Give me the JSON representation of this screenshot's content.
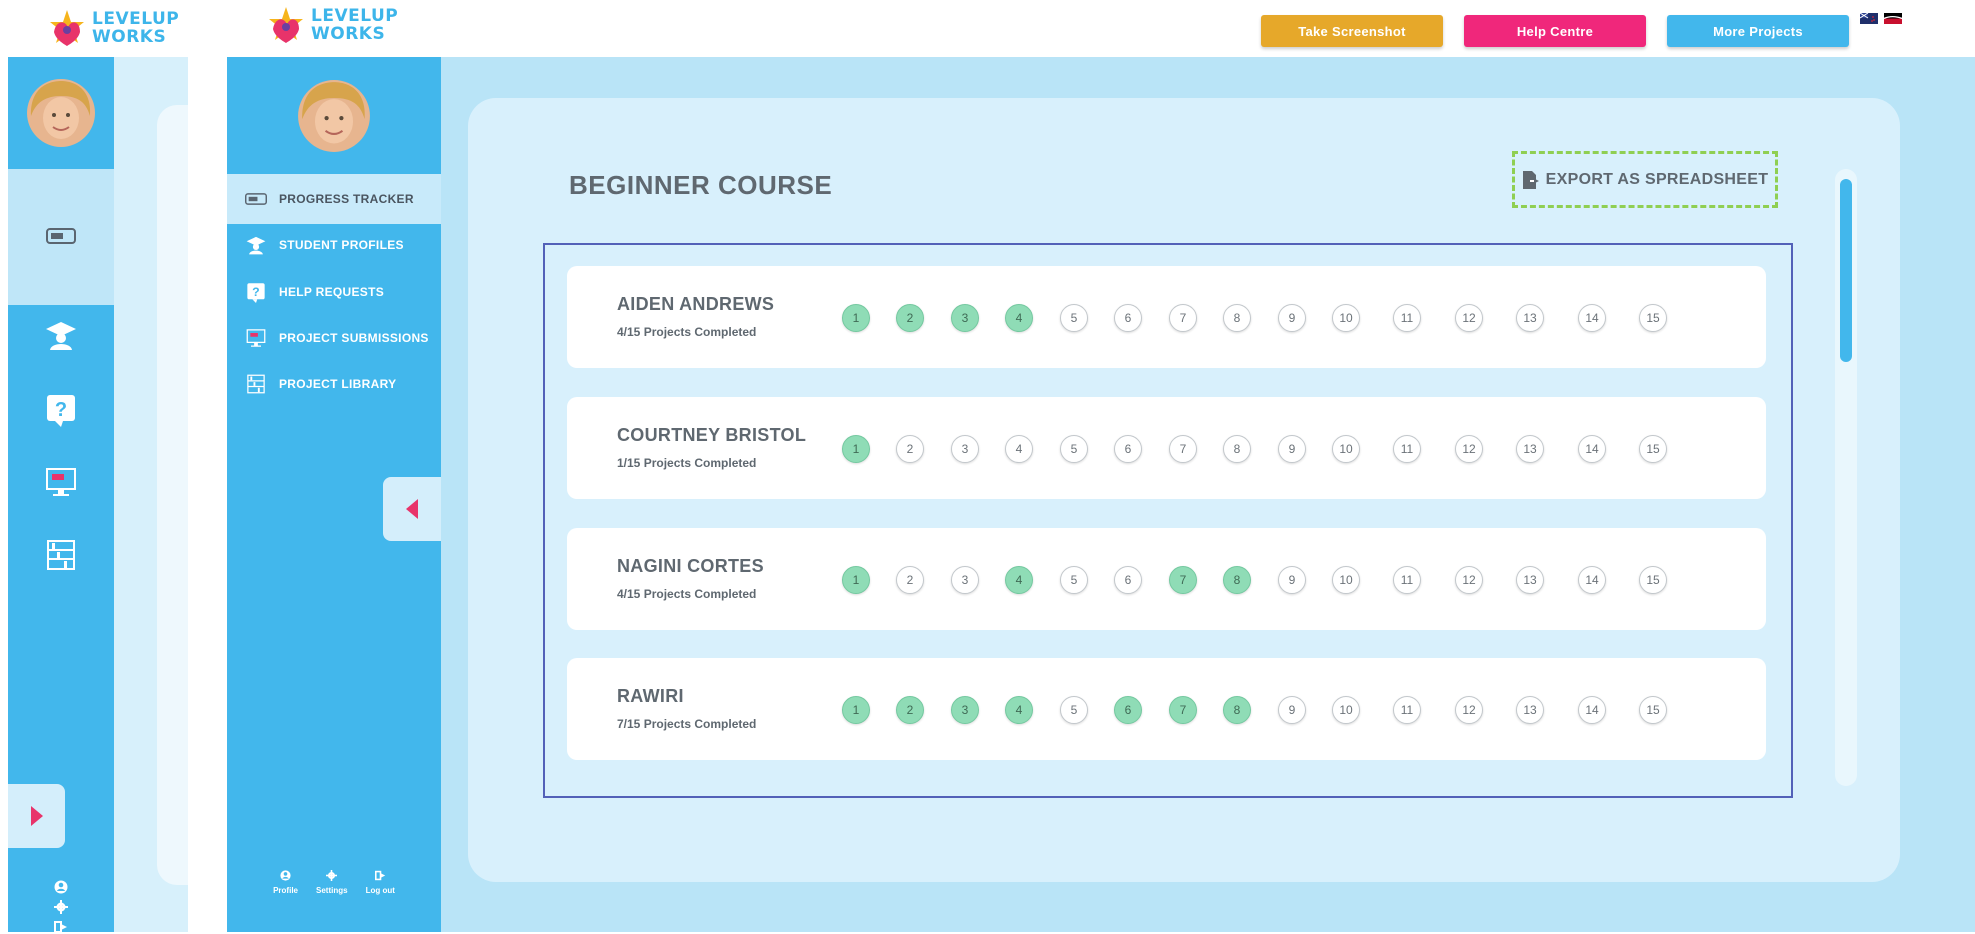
{
  "brand": {
    "line1": "LEVELUP",
    "line2": "WORKS"
  },
  "topbar": {
    "screenshot": "Take Screenshot",
    "help": "Help Centre",
    "more": "More Projects",
    "colors": {
      "screenshot": "#e6a82a",
      "help": "#f0277b",
      "more": "#42b7ec"
    }
  },
  "sidebar": {
    "items": [
      {
        "label": "PROGRESS TRACKER",
        "icon": "progress-bar-icon",
        "active": true
      },
      {
        "label": "STUDENT PROFILES",
        "icon": "graduate-icon"
      },
      {
        "label": "HELP REQUESTS",
        "icon": "question-icon"
      },
      {
        "label": "PROJECT SUBMISSIONS",
        "icon": "monitor-icon"
      },
      {
        "label": "PROJECT LIBRARY",
        "icon": "bookshelf-icon"
      }
    ],
    "bottom": {
      "profile": "Profile",
      "settings": "Settings",
      "logout": "Log out"
    }
  },
  "main": {
    "title": "BEGINNER COURSE",
    "export": "EXPORT AS SPREADSHEET",
    "students": [
      {
        "name": "AIDEN ANDREWS",
        "progress": "4/15 Projects Completed",
        "completed": [
          1,
          2,
          3,
          4
        ]
      },
      {
        "name": "COURTNEY BRISTOL",
        "progress": "1/15 Projects Completed",
        "completed": [
          1
        ]
      },
      {
        "name": "NAGINI CORTES",
        "progress": "4/15 Projects Completed",
        "completed": [
          1,
          4,
          7,
          8
        ]
      },
      {
        "name": "RAWIRI",
        "progress": "7/15 Projects Completed",
        "completed": [
          1,
          2,
          3,
          4,
          6,
          7,
          8
        ]
      }
    ],
    "projects": [
      "1",
      "2",
      "3",
      "4",
      "5",
      "6",
      "7",
      "8",
      "9",
      "10",
      "11",
      "12",
      "13",
      "14",
      "15"
    ]
  },
  "colors": {
    "accent": "#42b7ec",
    "done": "#8fdcb6",
    "export_border": "#8fcf52"
  }
}
